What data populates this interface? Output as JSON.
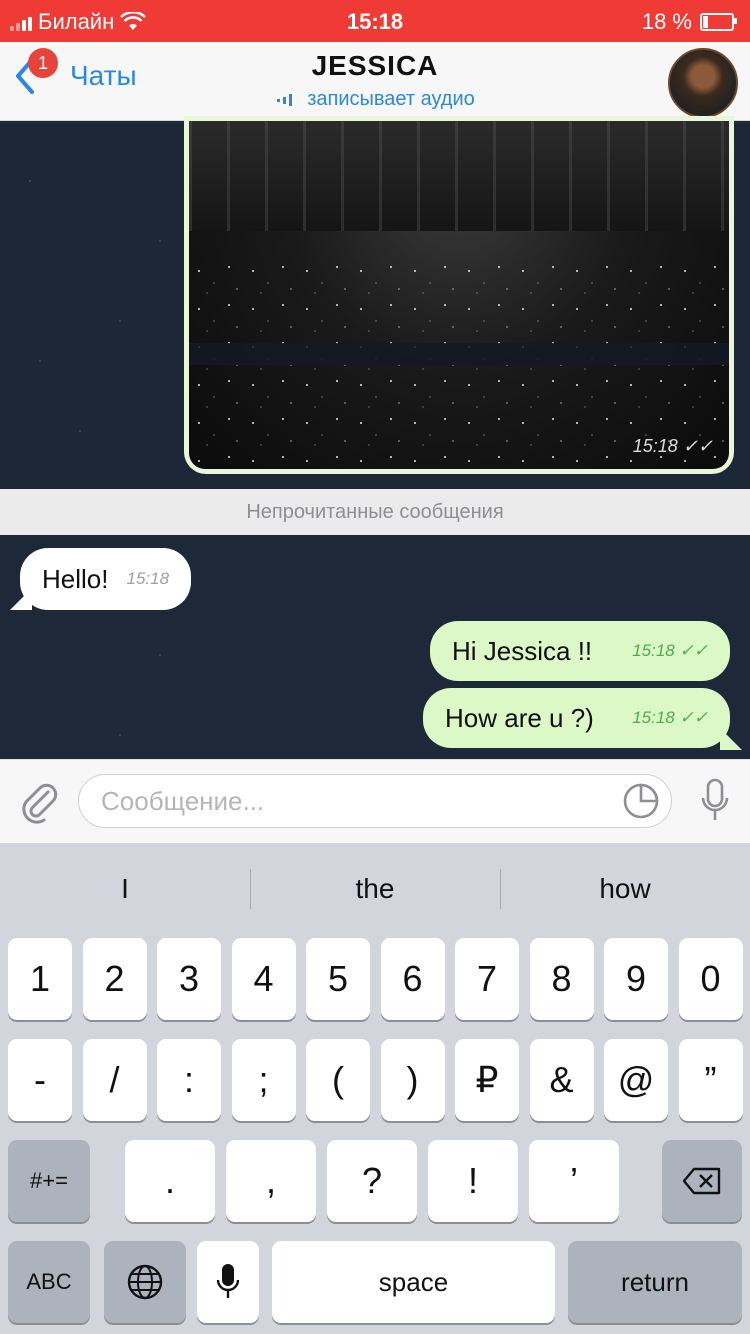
{
  "status_bar": {
    "carrier": "Билайн",
    "time": "15:18",
    "battery": "18 %",
    "battery_level": 0.18
  },
  "nav": {
    "back_badge": "1",
    "back_label": "Чаты",
    "title": "JESSICA",
    "subtitle": "записывает аудио"
  },
  "photo_message": {
    "time": "15:18"
  },
  "unread_divider": "Непрочитанные сообщения",
  "messages": [
    {
      "direction": "in",
      "text": "Hello!",
      "time": "15:18"
    },
    {
      "direction": "out",
      "text": "Hi Jessica !!",
      "time": "15:18"
    },
    {
      "direction": "out",
      "text": "How are u ?)",
      "time": "15:18"
    }
  ],
  "input": {
    "placeholder": "Сообщение..."
  },
  "keyboard": {
    "suggestions": [
      "I",
      "the",
      "how"
    ],
    "row1": [
      "1",
      "2",
      "3",
      "4",
      "5",
      "6",
      "7",
      "8",
      "9",
      "0"
    ],
    "row2": [
      "-",
      "/",
      ":",
      ";",
      "(",
      ")",
      "₽",
      "&",
      "@",
      "”"
    ],
    "row3_left": "#+=",
    "row3": [
      ".",
      ",",
      "?",
      "!",
      "’"
    ],
    "row4": {
      "abc": "ABC",
      "space": "space",
      "return": "return"
    }
  },
  "colors": {
    "status_bar": "#f03a36",
    "accent": "#2a88e0",
    "outgoing_bubble": "#dcf8c6",
    "chat_background": "#1c2738"
  }
}
